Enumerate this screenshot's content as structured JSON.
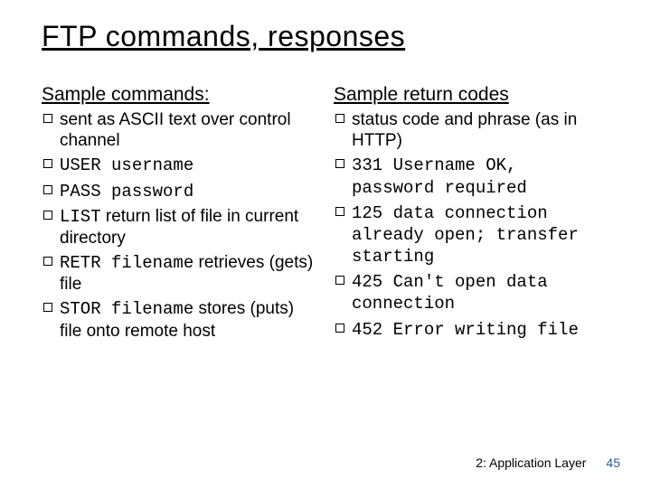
{
  "title": "FTP commands, responses",
  "left": {
    "heading": "Sample commands:",
    "items": {
      "i0": {
        "t1": "sent as ASCII text over control channel"
      },
      "i1": {
        "c1": "USER username"
      },
      "i2": {
        "c1": "PASS password"
      },
      "i3": {
        "c1": "LIST",
        "t1": " return list of file in current directory"
      },
      "i4": {
        "c1": "RETR filename",
        "t1": " retrieves (gets) file"
      },
      "i5": {
        "c1": "STOR filename",
        "t1": " stores (puts) file onto remote host"
      }
    }
  },
  "right": {
    "heading": "Sample return codes",
    "items": {
      "i0": {
        "t1": "status code and phrase (as in HTTP)"
      },
      "i1": {
        "c1": "331 Username OK, password required"
      },
      "i2": {
        "c1": "125 data connection already open; transfer starting"
      },
      "i3": {
        "c1": "425 Can't open data connection"
      },
      "i4": {
        "c1": "452 Error writing file"
      }
    }
  },
  "footer": {
    "chapter": "2: Application Layer",
    "page": "45"
  }
}
